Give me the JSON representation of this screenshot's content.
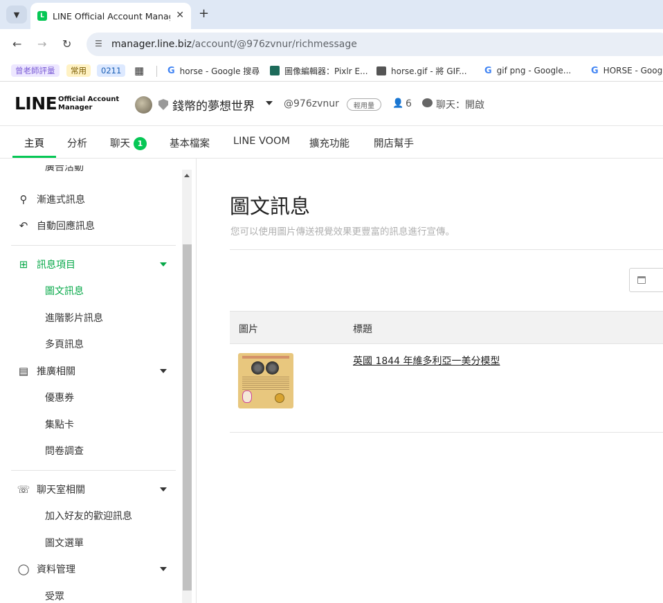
{
  "browser": {
    "tab_menu_icon": "chevron-down-icon",
    "tab_title": "LINE Official Account Manage",
    "tab_favicon_letter": "L",
    "tab_close_symbol": "✕",
    "new_tab_symbol": "+",
    "url_host": "manager.line.biz",
    "url_path": "/account/@976zvnur/richmessage"
  },
  "bookmarks": [
    {
      "label": "曾老師評量",
      "color": "#7b5cd6",
      "bg": "#ede7ff"
    },
    {
      "label": "常用",
      "color": "#7a5b00",
      "bg": "#fff2c4"
    },
    {
      "label": "0211",
      "color": "#1a5fb4",
      "bg": "#dde9ff"
    },
    {
      "label": "horse - Google 搜尋"
    },
    {
      "label": "圖像編輯器：Pixlr E..."
    },
    {
      "label": "horse.gif - 將 GIF..."
    },
    {
      "label": "gif png - Google..."
    },
    {
      "label": "HORSE - Googl"
    }
  ],
  "app": {
    "logo_main": "LINE",
    "logo_sub_1": "Official Account",
    "logo_sub_2": "Manager",
    "account_name": "錢幣的夢想世界",
    "account_id": "@976zvnur",
    "plan_badge": "輕用量",
    "friends_count": "6",
    "chat_status": "聊天：開啟"
  },
  "nav": {
    "tabs": [
      {
        "label": "主頁"
      },
      {
        "label": "分析"
      },
      {
        "label": "聊天",
        "badge": "1"
      },
      {
        "label": "基本檔案"
      },
      {
        "label": "LINE VOOM"
      },
      {
        "label": "擴充功能"
      },
      {
        "label": "開店幫手"
      }
    ],
    "active_tab": "主頁"
  },
  "sidebar": {
    "partial_top": "廣告活動",
    "items": [
      {
        "label": "漸進式訊息",
        "icon": "sitemap-icon"
      },
      {
        "label": "自動回應訊息",
        "icon": "reply-icon"
      },
      {
        "label": "訊息項目",
        "icon": "add-message-icon",
        "expanded": true,
        "active": true
      },
      {
        "label": "圖文訊息",
        "sub": true,
        "active": true
      },
      {
        "label": "進階影片訊息",
        "sub": true
      },
      {
        "label": "多頁訊息",
        "sub": true
      },
      {
        "label": "推廣相關",
        "icon": "shop-icon",
        "expanded": true
      },
      {
        "label": "優惠券",
        "sub": true
      },
      {
        "label": "集點卡",
        "sub": true
      },
      {
        "label": "問卷調查",
        "sub": true
      },
      {
        "label": "聊天室相關",
        "icon": "phone-chat-icon",
        "expanded": true
      },
      {
        "label": "加入好友的歡迎訊息",
        "sub": true
      },
      {
        "label": "圖文選單",
        "sub": true
      },
      {
        "label": "資料管理",
        "icon": "database-icon",
        "expanded": true
      },
      {
        "label": "受眾",
        "sub": true
      }
    ]
  },
  "main": {
    "title": "圖文訊息",
    "description": "您可以使用圖片傳送視覺效果更豐富的訊息進行宣傳。",
    "table": {
      "columns": [
        "圖片",
        "標題"
      ],
      "rows": [
        {
          "image": "rich-message-thumbnail",
          "title": "英國 1844 年維多利亞一美分模型"
        }
      ]
    }
  },
  "colors": {
    "line_green": "#06c755",
    "active_green": "#06a848"
  }
}
